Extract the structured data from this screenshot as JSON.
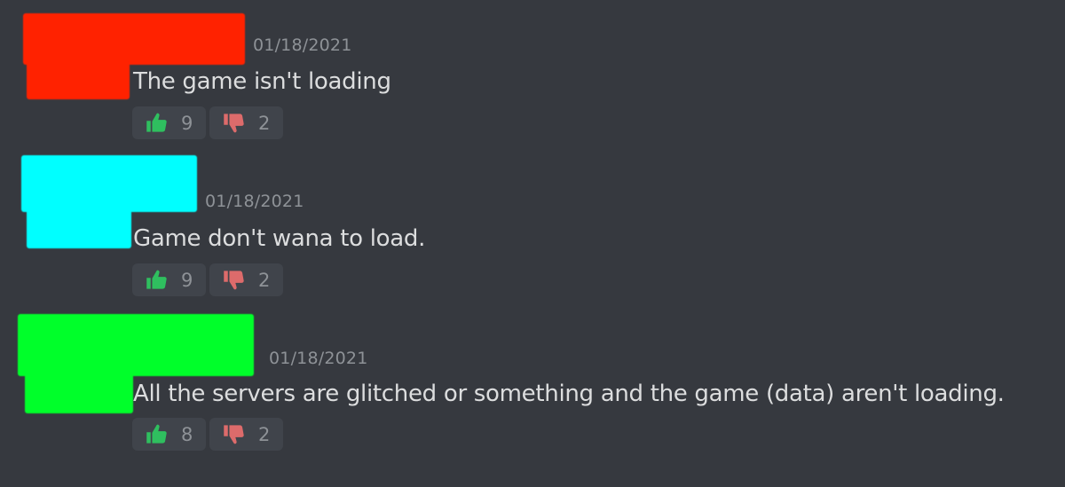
{
  "colors": {
    "background": "#36393f",
    "reaction_bg": "#40444b",
    "text": "#dcddde",
    "muted": "#8e9297",
    "thumbs_up": "#2fbf5f",
    "thumbs_down": "#dd6b6b",
    "redact_red": "#ff2200",
    "redact_cyan": "#00ffff",
    "redact_green": "#00ff2a"
  },
  "messages": [
    {
      "timestamp": "01/18/2021",
      "content": "The game isn't loading",
      "redaction_color": "#ff2200",
      "reactions": [
        {
          "icon": "thumbs-up-icon",
          "count": "9"
        },
        {
          "icon": "thumbs-down-icon",
          "count": "2"
        }
      ]
    },
    {
      "timestamp": "01/18/2021",
      "content": "Game don't wana to load.",
      "redaction_color": "#00ffff",
      "reactions": [
        {
          "icon": "thumbs-up-icon",
          "count": "9"
        },
        {
          "icon": "thumbs-down-icon",
          "count": "2"
        }
      ]
    },
    {
      "timestamp": "01/18/2021",
      "content": "All the servers are glitched or something and the game (data) aren't loading.",
      "redaction_color": "#00ff2a",
      "reactions": [
        {
          "icon": "thumbs-up-icon",
          "count": "8"
        },
        {
          "icon": "thumbs-down-icon",
          "count": "2"
        }
      ]
    }
  ]
}
